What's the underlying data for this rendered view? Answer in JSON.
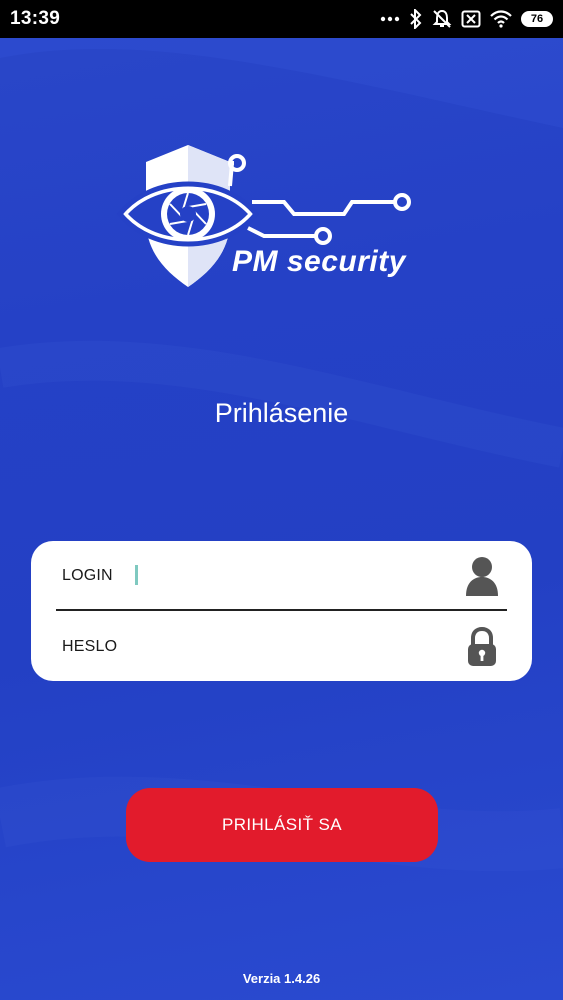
{
  "status_bar": {
    "time": "13:39",
    "battery": "76",
    "icons": [
      "more-dots-icon",
      "bluetooth-icon",
      "notifications-off-icon",
      "sim-x-icon",
      "wifi-icon",
      "battery-icon"
    ]
  },
  "logo": {
    "brand_text": "PM security",
    "icon": "shield-eye-circuit-logo"
  },
  "page": {
    "title": "Prihlásenie"
  },
  "form": {
    "login_label": "LOGIN",
    "login_value": "",
    "login_icon": "user-icon",
    "password_label": "HESLO",
    "password_value": "",
    "password_icon": "lock-icon"
  },
  "actions": {
    "login_button": "PRIHLÁSIŤ SA"
  },
  "footer": {
    "version": "Verzia 1.4.26"
  },
  "colors": {
    "background": "#2541c6",
    "button": "#e21b2c",
    "card": "#ffffff",
    "caret": "#7fc9c0"
  }
}
